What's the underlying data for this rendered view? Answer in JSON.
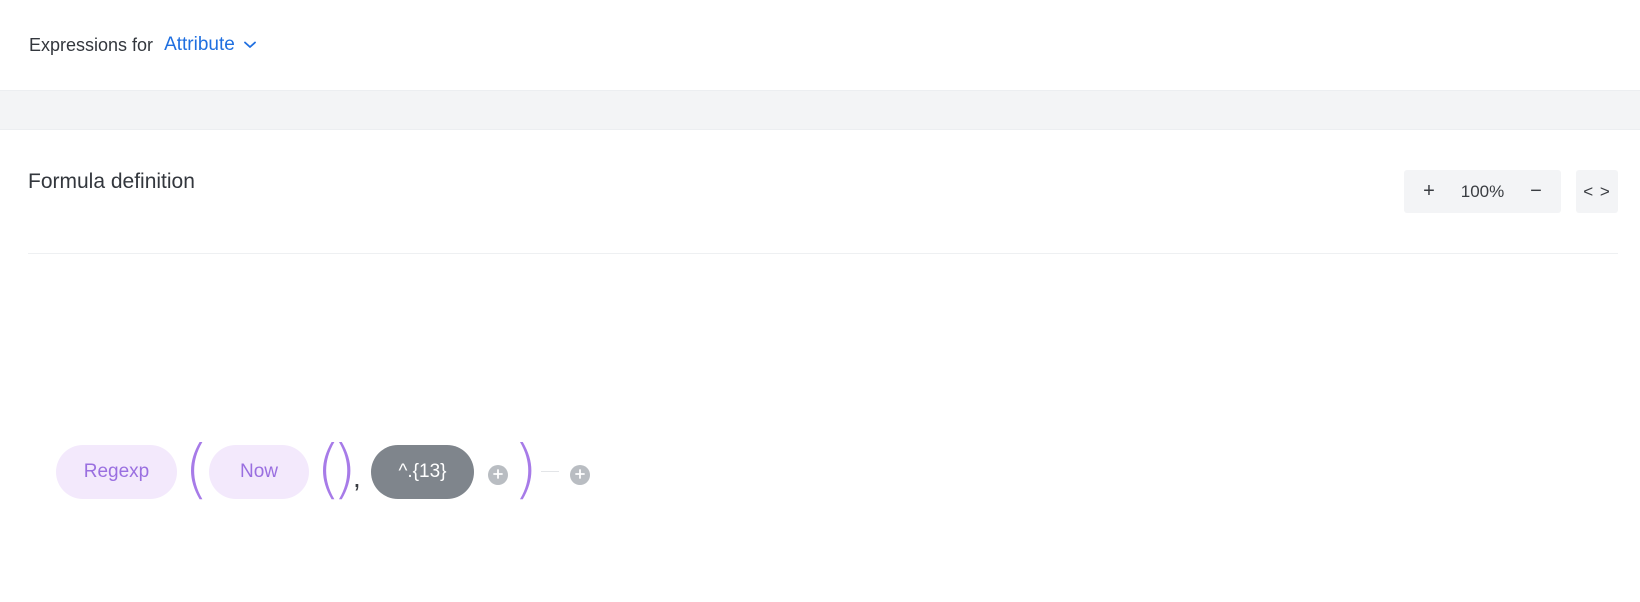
{
  "header": {
    "label": "Expressions for",
    "entity_selected": "Attribute"
  },
  "section": {
    "title": "Formula definition"
  },
  "zoom": {
    "plus_label": "+",
    "level": "100%",
    "minus_label": "−",
    "code_label": "< >"
  },
  "formula": {
    "functions": [
      "Regexp",
      "Now"
    ],
    "value": "^.{13}",
    "open_paren": "(",
    "close_paren": ")",
    "comma": ","
  },
  "colors": {
    "accent_blue": "#1f6fe0",
    "function_bg": "#f3e9fc",
    "function_text": "#9a6fe0",
    "paren": "#a77be8",
    "value_bg": "#7f858c"
  },
  "icons": {
    "dropdown": "chevron-down-icon",
    "add": "plus-circle-icon"
  }
}
